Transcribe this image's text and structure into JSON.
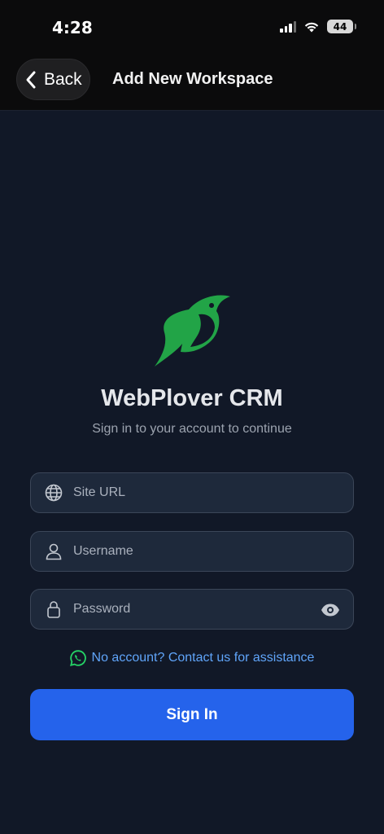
{
  "status_bar": {
    "time": "4:28",
    "battery_level": "44",
    "signal_icon": "cellular-signal-icon",
    "wifi_icon": "wifi-icon"
  },
  "header": {
    "back_label": "Back",
    "title": "Add New Workspace"
  },
  "brand": {
    "logo_icon": "plover-bird-logo",
    "name": "WebPlover CRM",
    "subtitle": "Sign in to your account to continue",
    "logo_color": "#22a447"
  },
  "form": {
    "site_url": {
      "placeholder": "Site URL",
      "value": "",
      "icon": "globe-icon"
    },
    "username": {
      "placeholder": "Username",
      "value": "",
      "icon": "user-icon"
    },
    "password": {
      "placeholder": "Password",
      "value": "",
      "icon": "lock-icon",
      "toggle_icon": "eye-icon"
    },
    "contact_link": "No account? Contact us for assistance",
    "contact_icon": "whatsapp-icon",
    "submit_label": "Sign In"
  },
  "colors": {
    "background": "#111827",
    "field_bg": "#1e293b",
    "primary": "#2563eb",
    "link": "#60a5fa",
    "whatsapp": "#25d366"
  }
}
